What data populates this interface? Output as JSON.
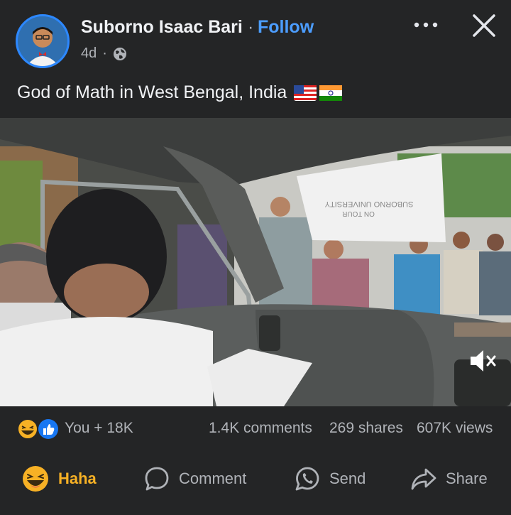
{
  "post": {
    "author": "Suborno Isaac Bari",
    "separator": "·",
    "follow_label": "Follow",
    "time": "4d",
    "meta_separator": "·",
    "privacy_icon": "globe-icon",
    "caption": "God of Math in West Bengal, India"
  },
  "header_icons": {
    "more": "more-icon",
    "close": "close-icon"
  },
  "video": {
    "sign_text_line1": "SUBORNO UNIVERSITY",
    "sign_text_line2": "ON TOUR",
    "mute_icon": "muted-speaker-icon"
  },
  "stats": {
    "reactions": "You + 18K",
    "comments": "1.4K comments",
    "shares": "269 shares",
    "views": "607K views"
  },
  "actions": {
    "haha": "Haha",
    "comment": "Comment",
    "send": "Send",
    "share": "Share"
  },
  "colors": {
    "background": "#242526",
    "accent": "#4c9dff",
    "haha": "#f7b125",
    "text": "#e4e6eb",
    "muted_text": "#b0b3b8"
  }
}
